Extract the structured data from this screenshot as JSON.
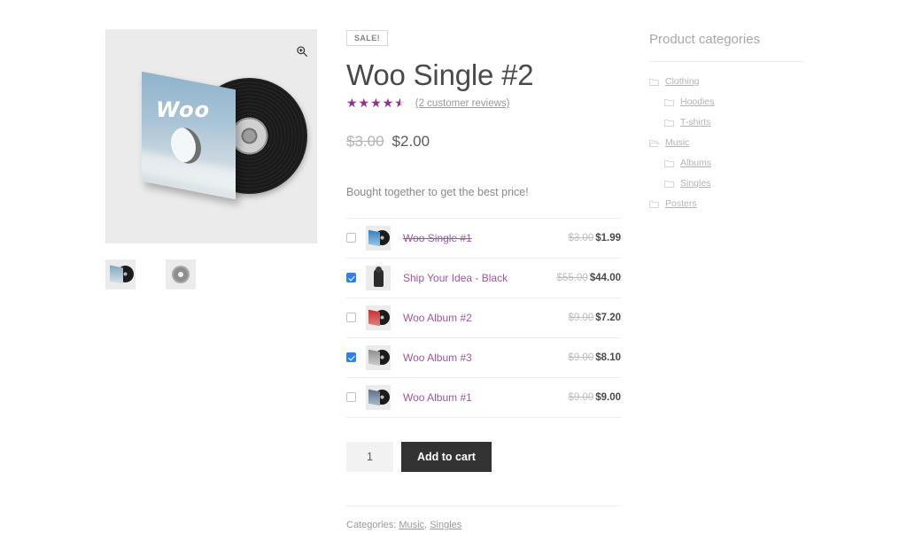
{
  "gallery": {
    "zoom_icon": "magnifier-zoom-icon",
    "main_image_alt": "Woo Single #2 vinyl record in sky sleeve",
    "sleeve_word": "Woo",
    "thumbnails": [
      {
        "name": "vinyl-sleeve-thumbnail"
      },
      {
        "name": "record-label-thumbnail"
      }
    ]
  },
  "summary": {
    "sale_badge": "SALE!",
    "title": "Woo Single #2",
    "rating": {
      "value": 4.5,
      "max": 5,
      "stars_glyphs": "★★★★★",
      "reviews_link": "(2 customer reviews)"
    },
    "price_old": "$3.00",
    "price_new": "$2.00",
    "bundle_heading": "Bought together to get the best price!",
    "bundle_items": [
      {
        "checked": false,
        "name": "Woo Single #1",
        "struck": true,
        "price_old": "$3.00",
        "price_new": "$1.99",
        "thumb": "vinyl-blue"
      },
      {
        "checked": true,
        "name": "Ship Your Idea - Black",
        "struck": false,
        "price_old": "$55.00",
        "price_new": "$44.00",
        "thumb": "hoodie-black"
      },
      {
        "checked": false,
        "name": "Woo Album #2",
        "struck": false,
        "price_old": "$9.00",
        "price_new": "$7.20",
        "thumb": "vinyl-red"
      },
      {
        "checked": true,
        "name": "Woo Album #3",
        "struck": false,
        "price_old": "$9.00",
        "price_new": "$8.10",
        "thumb": "vinyl-grey"
      },
      {
        "checked": false,
        "name": "Woo Album #1",
        "struck": false,
        "price_old": "$9.00",
        "price_new": "$9.00",
        "thumb": "vinyl-navy"
      }
    ],
    "quantity_value": "1",
    "add_to_cart_label": "Add to cart",
    "meta_label": "Categories:",
    "meta_categories": [
      "Music",
      "Singles"
    ]
  },
  "sidebar": {
    "title": "Product categories",
    "categories": [
      {
        "label": "Clothing",
        "level": 0,
        "open": false
      },
      {
        "label": "Hoodies",
        "level": 1,
        "open": false
      },
      {
        "label": "T-shirts",
        "level": 1,
        "open": false
      },
      {
        "label": "Music",
        "level": 0,
        "open": true
      },
      {
        "label": "Albums",
        "level": 1,
        "open": false
      },
      {
        "label": "Singles",
        "level": 1,
        "open": false
      },
      {
        "label": "Posters",
        "level": 0,
        "open": false
      }
    ]
  },
  "colors": {
    "accent_purple": "#92308f",
    "link_purple": "#a0569e",
    "checkbox_blue": "#2f80ed",
    "button_dark": "#333333",
    "image_bg": "#ebebeb"
  }
}
